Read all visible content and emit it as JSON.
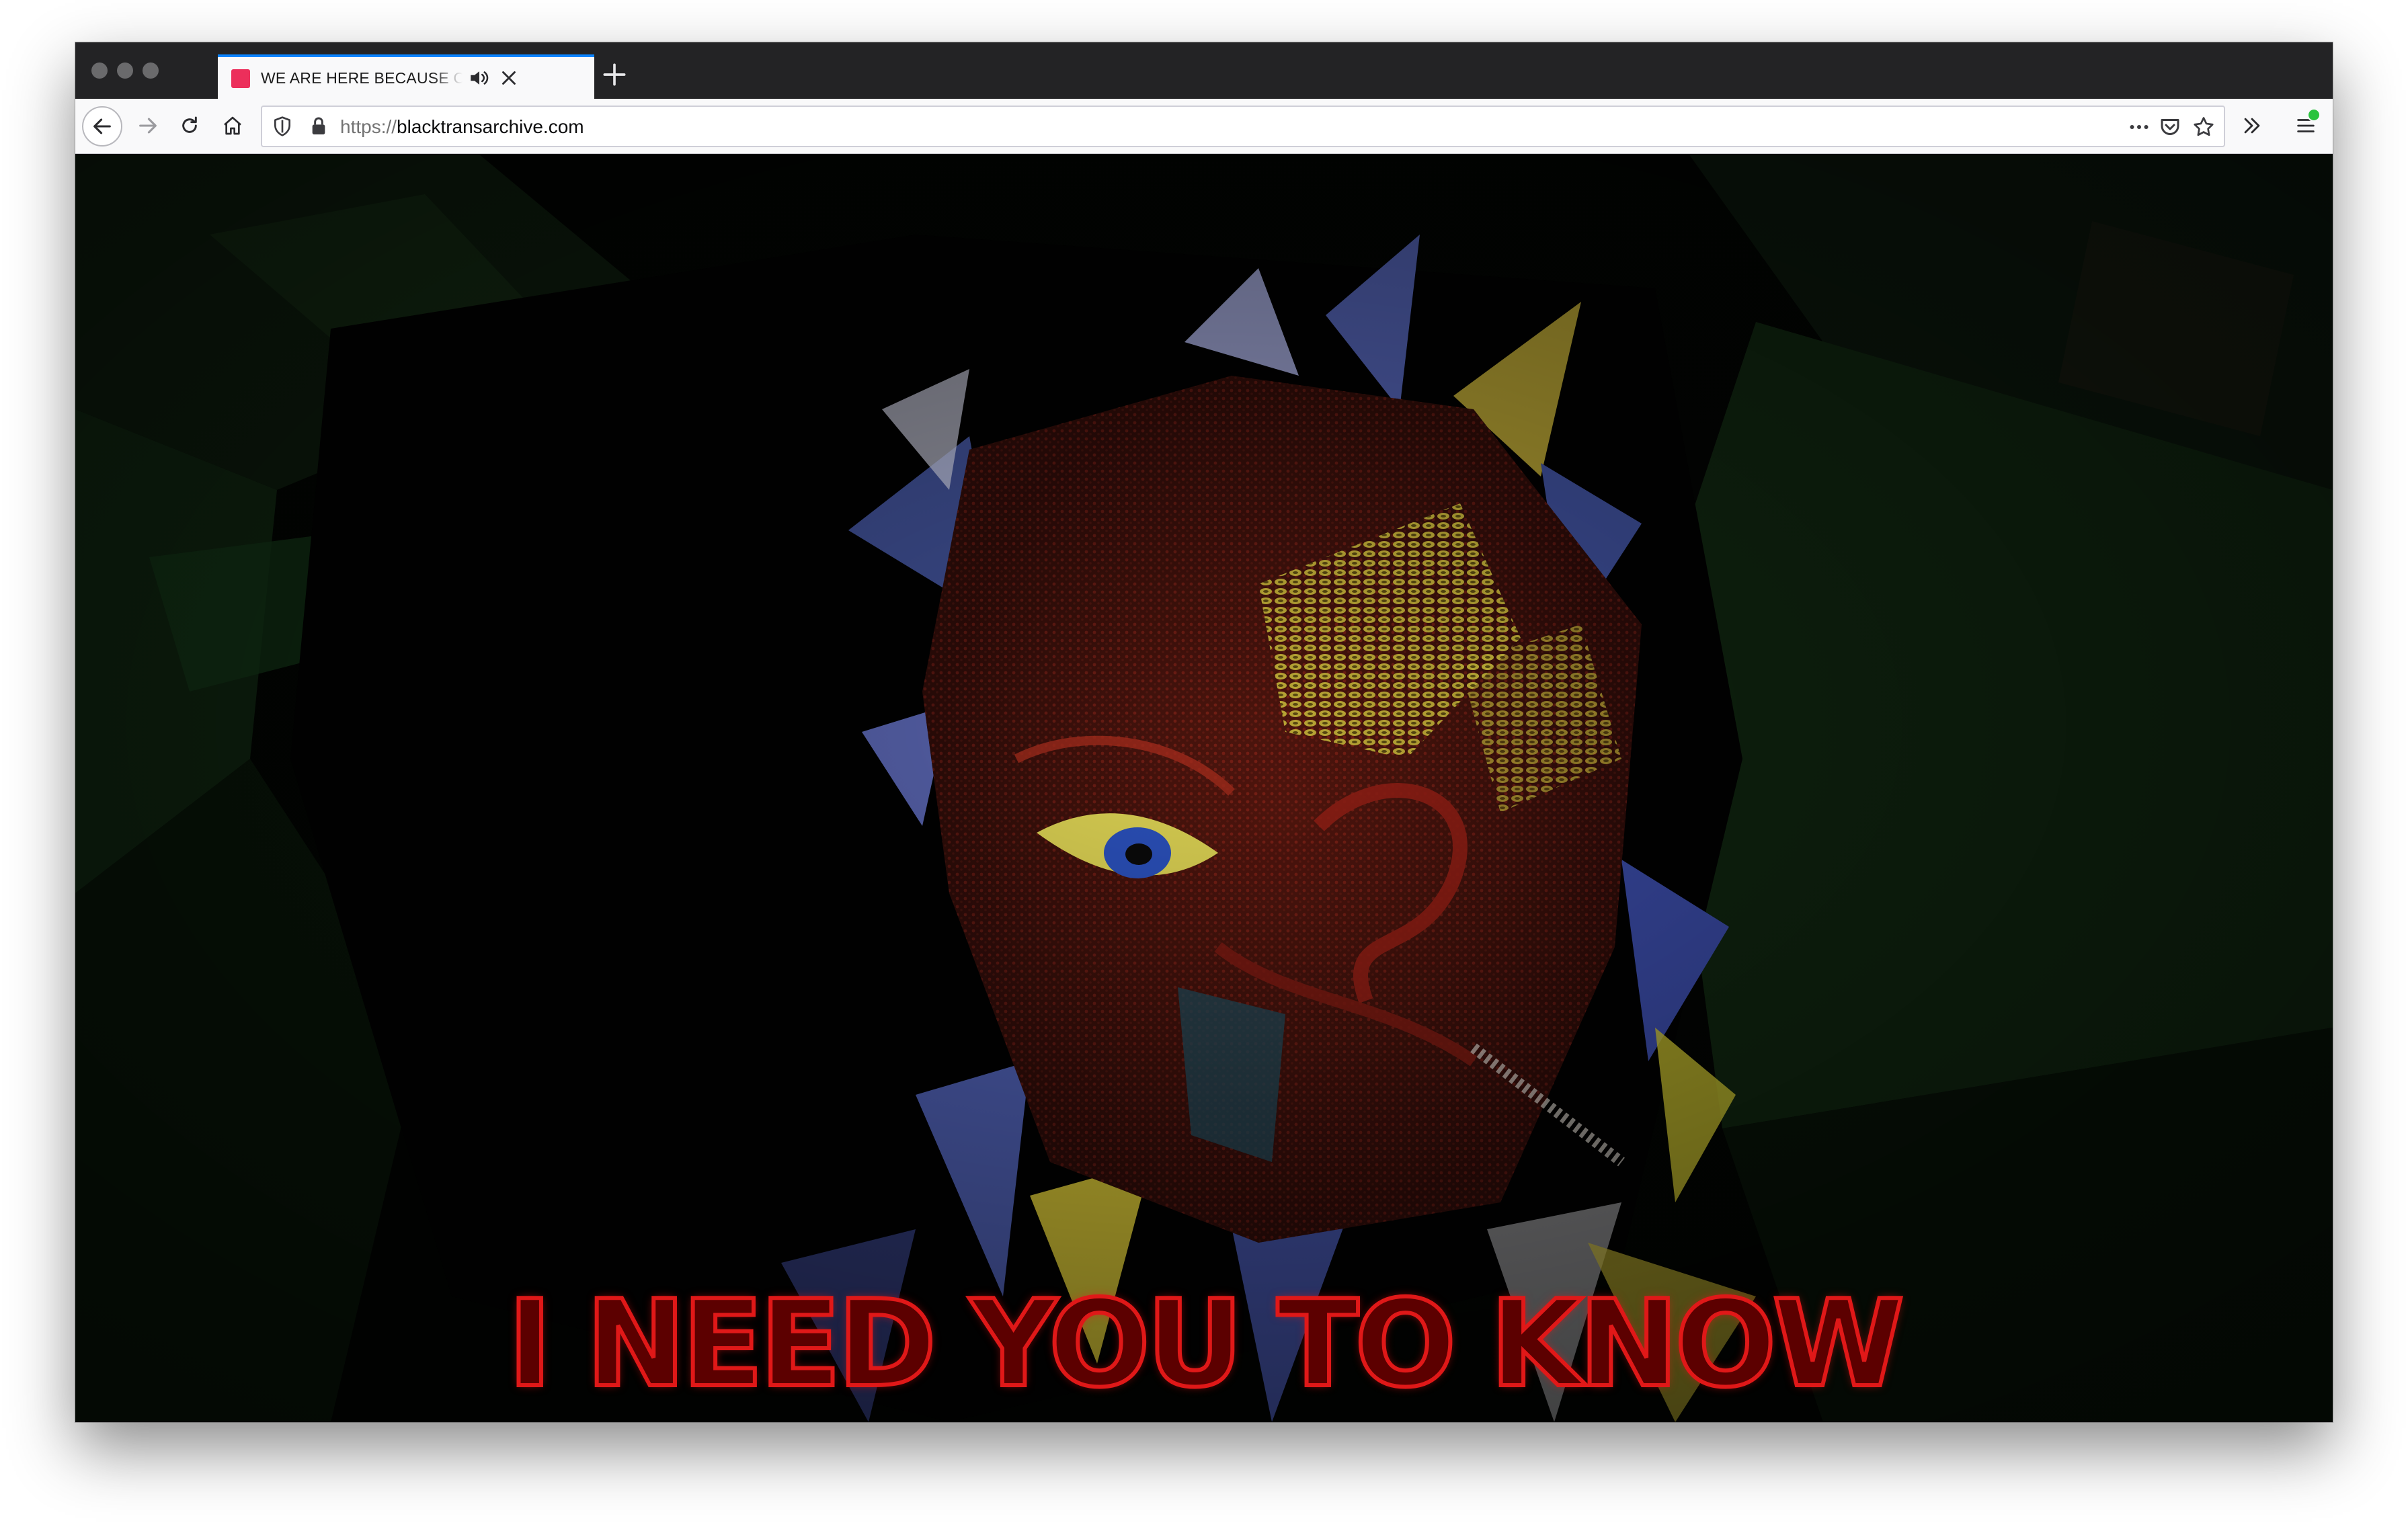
{
  "browser": {
    "tab": {
      "title": "WE ARE HERE BECAUSE OF",
      "favicon_color": "#ec2f5b",
      "audio_icon": "speaker-icon",
      "close_icon": "close-icon"
    },
    "new_tab_icon": "plus-icon",
    "nav": {
      "back_icon": "arrow-left-icon",
      "forward_icon": "arrow-right-icon",
      "reload_icon": "reload-icon",
      "home_icon": "home-icon"
    },
    "url": {
      "protocol": "https://",
      "host": "blacktransarchive.com"
    },
    "url_actions": [
      "more-dots-icon",
      "pocket-icon",
      "star-icon"
    ],
    "overflow_icon": "double-chevron-right-icon",
    "menu_icon": "hamburger-menu-icon",
    "menu_badge_color": "#2ac33e",
    "accent_color": "#0a84ff"
  },
  "page": {
    "caption": "I NEED YOU TO KNOW",
    "caption_fill_color": "#5c0000",
    "caption_outline_color": "#e01818",
    "background_color": "#020402"
  }
}
